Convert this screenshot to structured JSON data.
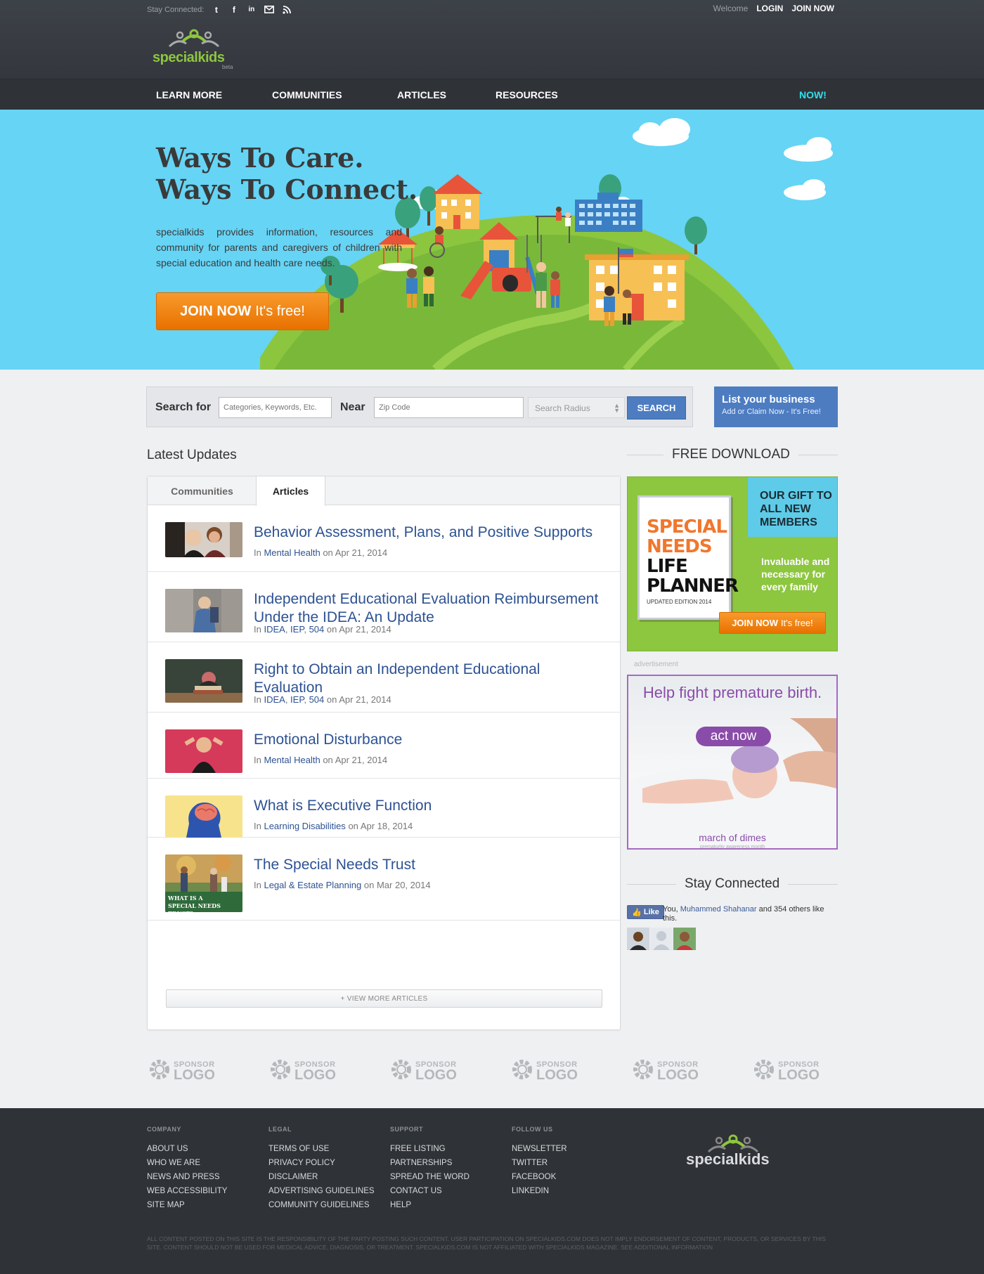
{
  "header": {
    "stay_connected": "Stay Connected:",
    "social": [
      "twitter-icon",
      "facebook-icon",
      "linkedin-icon",
      "email-icon",
      "rss-icon"
    ],
    "welcome": "Welcome",
    "login": "LOGIN",
    "join_now": "JOIN NOW",
    "logo_text": "specialkids",
    "beta": "beta"
  },
  "nav": {
    "items": [
      "LEARN MORE",
      "COMMUNITIES",
      "ARTICLES",
      "RESOURCES"
    ],
    "now": "NOW!"
  },
  "hero": {
    "title_line1": "Ways To Care.",
    "title_line2": "Ways To Connect.",
    "text": "specialkids provides information, resources and community for parents and caregivers of children with special education and health care needs.",
    "join_bold": "JOIN NOW",
    "join_rest": "It's free!"
  },
  "search": {
    "search_for": "Search for",
    "keyword_placeholder": "Categories, Keywords, Etc.",
    "near": "Near",
    "zip_placeholder": "Zip Code",
    "radius": "Search Radius",
    "button": "SEARCH"
  },
  "list_business": {
    "title": "List your business",
    "subtitle": "Add or Claim Now - It's Free!"
  },
  "updates": {
    "title": "Latest Updates",
    "tabs": [
      "Communities",
      "Articles"
    ],
    "active_tab": "Articles",
    "articles": [
      {
        "title": "Behavior Assessment, Plans, and Positive Supports",
        "prefix": "In",
        "cats": [
          "Mental Health"
        ],
        "on": "on",
        "date": "Apr 21, 2014"
      },
      {
        "title": "Independent Educational Evaluation Reimbursement Under the IDEA: An Update",
        "prefix": "In",
        "cats": [
          "IDEA",
          "IEP",
          "504"
        ],
        "on": "on",
        "date": "Apr 21, 2014"
      },
      {
        "title": "Right to Obtain an Independent Educational Evaluation",
        "prefix": "In",
        "cats": [
          "IDEA",
          "IEP",
          "504"
        ],
        "on": "on",
        "date": "Apr 21, 2014"
      },
      {
        "title": "Emotional Disturbance",
        "prefix": "In",
        "cats": [
          "Mental Health"
        ],
        "on": "on",
        "date": "Apr 21, 2014"
      },
      {
        "title": "What is Executive Function",
        "prefix": "In",
        "cats": [
          "Learning Disabilities"
        ],
        "on": "on",
        "date": "Apr 18, 2014"
      },
      {
        "title": "The Special Needs Trust",
        "prefix": "In",
        "cats": [
          "Legal & Estate Planning"
        ],
        "on": "on",
        "date": "Mar 20, 2014",
        "thumb_caption1": "WHAT IS A",
        "thumb_caption2": "SPECIAL NEEDS TRUST?"
      }
    ],
    "view_more": "+ VIEW MORE ARTICLES"
  },
  "sidebar": {
    "free_download": "FREE DOWNLOAD",
    "promo": {
      "line1": "SPECIAL",
      "line2": "NEEDS",
      "line3": "LIFE",
      "line4": "PLANNER",
      "edition": "UPDATED EDITION 2014",
      "gift": "OUR GIFT TO ALL NEW MEMBERS",
      "invaluable": "Invaluable and necessary for every family",
      "join_bold": "JOIN NOW",
      "join_rest": "It's free!"
    },
    "ad_label": "advertisement",
    "ad": {
      "headline": "Help fight premature birth.",
      "button": "act now",
      "brand": "march of dimes",
      "sub": "prematurity awareness month"
    },
    "stay_connected": "Stay Connected",
    "fb": {
      "like": "Like",
      "you": "You,",
      "name": "Muhammed Shahanar",
      "rest": "and 354 others like this."
    }
  },
  "sponsors": {
    "line1": "SPONSOR",
    "line2": "LOGO"
  },
  "footer": {
    "columns": [
      {
        "heading": "COMPANY",
        "links": [
          "ABOUT US",
          "WHO WE ARE",
          "NEWS AND PRESS",
          "WEB ACCESSIBILITY",
          "SITE MAP"
        ]
      },
      {
        "heading": "LEGAL",
        "links": [
          "TERMS OF USE",
          "PRIVACY POLICY",
          "DISCLAIMER",
          "ADVERTISING GUIDELINES",
          "COMMUNITY GUIDELINES"
        ]
      },
      {
        "heading": "SUPPORT",
        "links": [
          "FREE LISTING",
          "PARTNERSHIPS",
          "SPREAD THE WORD",
          "CONTACT US",
          "HELP"
        ]
      },
      {
        "heading": "FOLLOW US",
        "links": [
          "NEWSLETTER",
          "TWITTER",
          "FACEBOOK",
          "LINKEDIN"
        ]
      }
    ],
    "logo_text": "specialkids",
    "legal": "ALL CONTENT POSTED ON THIS SITE IS THE RESPONSIBILITY OF THE PARTY POSTING SUCH CONTENT. USER PARTICIPATION ON SPECIALKIDS.COM DOES NOT IMPLY ENDORSEMENT OF CONTENT, PRODUCTS, OR SERVICES BY THIS SITE. CONTENT SHOULD NOT BE USED FOR MEDICAL ADVICE, DIAGNOSIS, OR TREATMENT. SPECIALKIDS.COM IS NOT AFFILIATED WITH SPECIALKIDS MAGAZINE. SEE ADDITIONAL INFORMATION"
  },
  "colors": {
    "header_bg": "#3d4148",
    "nav_bg": "#2f3237",
    "accent_cyan": "#2fe0ef",
    "hero_bg": "#66d4f5",
    "orange": "#f28a1a",
    "link_blue": "#2d5293",
    "search_blue": "#4d7cc1",
    "brand_green": "#8dc63f",
    "ad_purple": "#8a4ca9"
  }
}
